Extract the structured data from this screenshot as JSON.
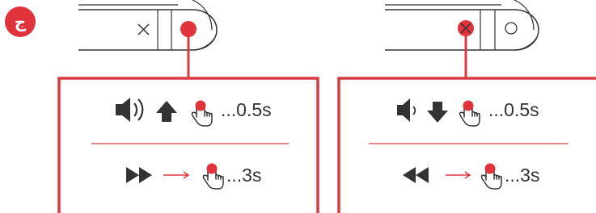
{
  "step_badge": {
    "label": "ج",
    "color": "#e0333c"
  },
  "colors": {
    "accent": "#e0333c",
    "stroke": "#333333",
    "panel_border": "#d63b40",
    "divider": "#d63b40"
  },
  "left_panel": {
    "device": {
      "buttons": [
        "close-x",
        "record-dot-active"
      ]
    },
    "row1": {
      "icons": [
        "volume-up-icon",
        "arrow-up-icon",
        "press-hand-icon"
      ],
      "duration": "...0.5s"
    },
    "row2": {
      "icons": [
        "fast-forward-icon",
        "arrow-right-icon",
        "press-hand-icon"
      ],
      "duration": "...3s"
    }
  },
  "right_panel": {
    "device": {
      "buttons": [
        "close-x-active",
        "circle"
      ]
    },
    "row1": {
      "icons": [
        "volume-down-icon",
        "arrow-down-icon",
        "press-hand-icon"
      ],
      "duration": "...0.5s"
    },
    "row2": {
      "icons": [
        "rewind-icon",
        "arrow-right-icon",
        "press-hand-icon"
      ],
      "duration": "...3s"
    }
  }
}
